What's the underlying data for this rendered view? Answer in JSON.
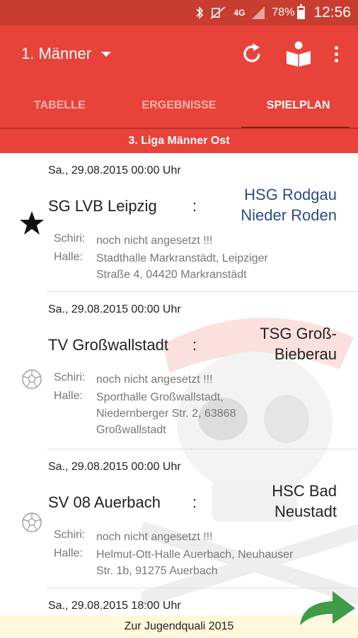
{
  "status": {
    "battery": "78%",
    "time": "12:56",
    "network": "4G"
  },
  "appbar": {
    "team": "1. Männer"
  },
  "tabs": [
    {
      "label": "TABELLE"
    },
    {
      "label": "ERGEBNISSE"
    },
    {
      "label": "SPIELPLAN"
    }
  ],
  "league": "3. Liga Männer Ost",
  "matches": [
    {
      "date": "Sa., 29.08.2015  00:00 Uhr",
      "home": "SG LVB Leipzig",
      "colon": ":",
      "away_line1": "HSG Rodgau",
      "away_line2": "Nieder Roden",
      "schiri_label": "Schiri:",
      "schiri": "noch nicht angesetzt !!!",
      "halle_label": "Halle:",
      "halle_line1": "Stadthalle Markranstädt, Leipziger",
      "halle_line2": "Straße 4, 04420 Markranstädt",
      "halle_line3": "",
      "icon": "star-icon"
    },
    {
      "date": "Sa., 29.08.2015  00:00 Uhr",
      "home": "TV Großwallstadt",
      "colon": ":",
      "away_line1": "TSG Groß-",
      "away_line2": "Bieberau",
      "schiri_label": "Schiri:",
      "schiri": "noch nicht angesetzt !!!",
      "halle_label": "Halle:",
      "halle_line1": "Sporthalle Großwallstadt,",
      "halle_line2": "Niedernberger Str. 2, 63868",
      "halle_line3": "Großwallstadt",
      "icon": "handball-icon"
    },
    {
      "date": "Sa., 29.08.2015  00:00 Uhr",
      "home": "SV 08 Auerbach",
      "colon": ":",
      "away_line1": "HSC Bad",
      "away_line2": "Neustadt",
      "schiri_label": "Schiri:",
      "schiri": "noch nicht angesetzt !!!",
      "halle_label": "Halle:",
      "halle_line1": "Helmut-Ott-Halle Auerbach, Neuhauser",
      "halle_line2": "Str. 1b, 91275 Auerbach",
      "halle_line3": "",
      "icon": "handball-icon"
    },
    {
      "date": "Sa., 29.08.2015  18:00 Uhr"
    }
  ],
  "bottom": {
    "label": "Zur Jugendquali 2015"
  },
  "colors": {
    "primary": "#e8433a",
    "statusbar": "#c93c30",
    "highlight_team": "#2b4d8c",
    "bottom_bar": "#fff8dc",
    "arrow": "#3f9c48"
  }
}
